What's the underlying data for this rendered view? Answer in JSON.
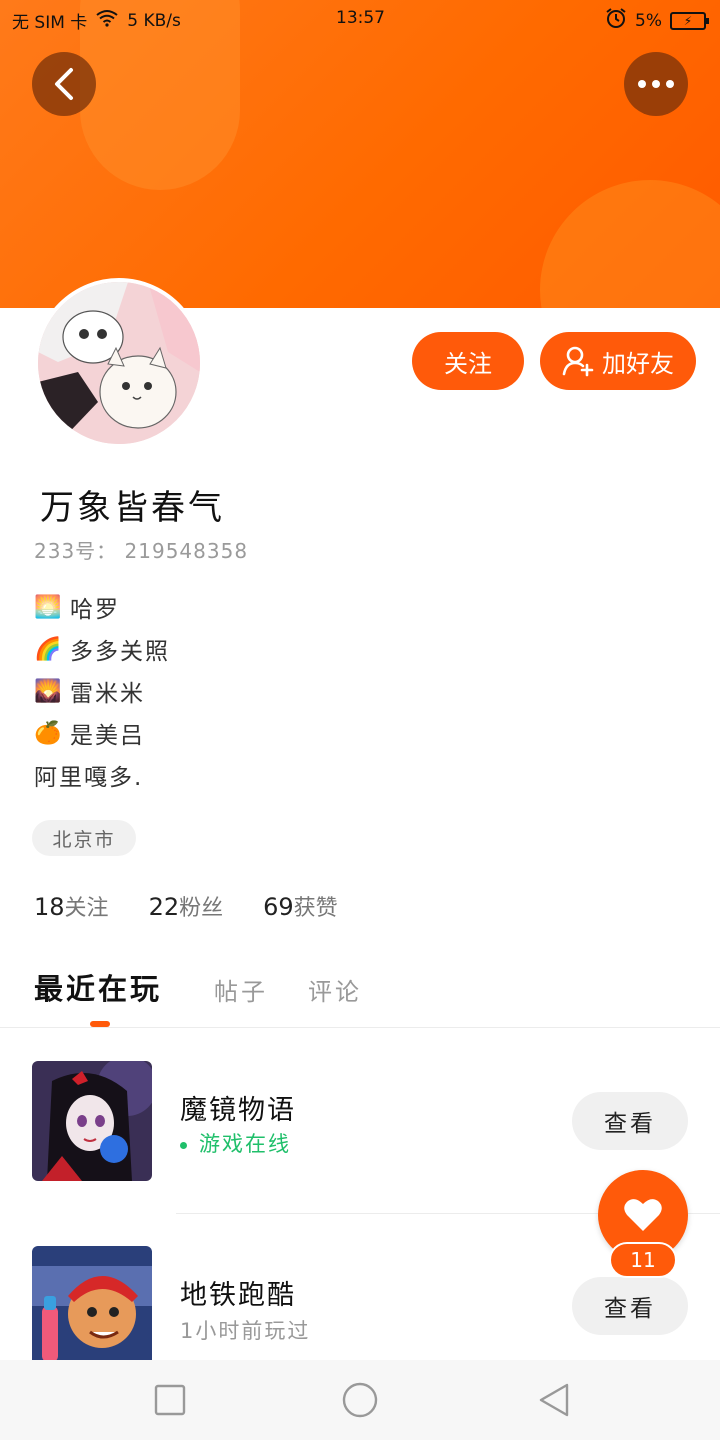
{
  "status_bar": {
    "carrier": "无 SIM 卡",
    "net_speed": "5 KB/s",
    "time": "13:57",
    "battery": "5%"
  },
  "header": {
    "back_icon": "chevron-left-icon",
    "more_icon": "ellipsis-icon",
    "accent_color": "#ff6a00"
  },
  "profile": {
    "follow_label": "关注",
    "add_friend_label": "加好友",
    "nickname": "万象皆春气",
    "uid": "233号： 219548358",
    "bio": [
      {
        "icon": "sunrise-emoji",
        "glyph": "🌅",
        "text": "哈罗"
      },
      {
        "icon": "rainbow-emoji",
        "glyph": "🌈",
        "text": "多多关照"
      },
      {
        "icon": "sunset-emoji",
        "glyph": "🌄",
        "text": "雷米米"
      },
      {
        "icon": "tangerine-emoji",
        "glyph": "🍊",
        "text": "是美吕"
      },
      {
        "icon": "",
        "glyph": "",
        "text": "阿里嘎多."
      }
    ],
    "location": "北京市",
    "stats": {
      "following_count": "18",
      "following_label": "关注",
      "fans_count": "22",
      "fans_label": "粉丝",
      "likes_count": "69",
      "likes_label": "获赞"
    }
  },
  "tabs": [
    {
      "label": "最近在玩"
    },
    {
      "label": "帖子"
    },
    {
      "label": "评论"
    }
  ],
  "games": [
    {
      "title": "魔镜物语",
      "status": "游戏在线",
      "status_color": "#1fbf6a",
      "action": "查看"
    },
    {
      "title": "地铁跑酷",
      "status": "1小时前玩过",
      "status_color": "#999999",
      "action": "查看"
    }
  ],
  "like_fab": {
    "icon": "heart-icon",
    "count": "11"
  },
  "nav_bar": {
    "recent_icon": "square-icon",
    "home_icon": "circle-icon",
    "back_icon": "triangle-back-icon"
  }
}
